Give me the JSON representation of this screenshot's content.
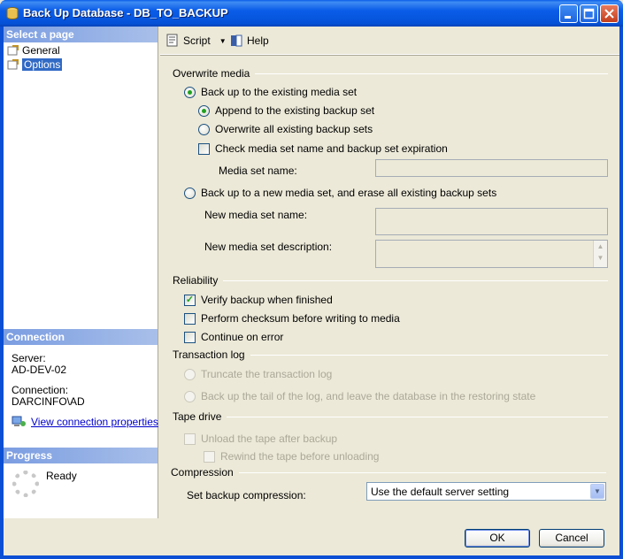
{
  "window": {
    "title": "Back Up Database - DB_TO_BACKUP"
  },
  "left_pane": {
    "select_page_header": "Select a page",
    "pages": [
      {
        "label": "General"
      },
      {
        "label": "Options"
      }
    ],
    "connection_header": "Connection",
    "server_label": "Server:",
    "server_value": "AD-DEV-02",
    "connection_label": "Connection:",
    "connection_value": "DARCINFO\\AD",
    "view_props_link": "View connection properties",
    "progress_header": "Progress",
    "progress_status": "Ready"
  },
  "toolbar": {
    "script_label": "Script",
    "help_label": "Help"
  },
  "overwrite_media": {
    "group_label": "Overwrite media",
    "existing_set_label": "Back up to the existing media set",
    "append_label": "Append to the existing backup set",
    "overwrite_label": "Overwrite all existing backup sets",
    "check_expiration_label": "Check media set name and backup set expiration",
    "media_set_name_label": "Media set name:",
    "media_set_name_value": "",
    "new_set_label": "Back up to a new media set, and erase all existing backup sets",
    "new_media_name_label": "New media set name:",
    "new_media_name_value": "",
    "new_media_desc_label": "New media set description:",
    "new_media_desc_value": ""
  },
  "reliability": {
    "group_label": "Reliability",
    "verify_label": "Verify backup when finished",
    "checksum_label": "Perform checksum before writing to media",
    "continue_label": "Continue on error"
  },
  "transaction_log": {
    "group_label": "Transaction log",
    "truncate_label": "Truncate the transaction log",
    "tail_label": "Back up the tail of the log, and leave the database in the restoring state"
  },
  "tape_drive": {
    "group_label": "Tape drive",
    "unload_label": "Unload the tape after backup",
    "rewind_label": "Rewind the tape before unloading"
  },
  "compression": {
    "group_label": "Compression",
    "set_label": "Set backup compression:",
    "selected": "Use the default server setting"
  },
  "buttons": {
    "ok": "OK",
    "cancel": "Cancel"
  },
  "colors": {
    "title_bar": "#0a5ce8",
    "section_header": "#7b9de1",
    "selection": "#316ac5",
    "check_mark": "#21a121"
  }
}
